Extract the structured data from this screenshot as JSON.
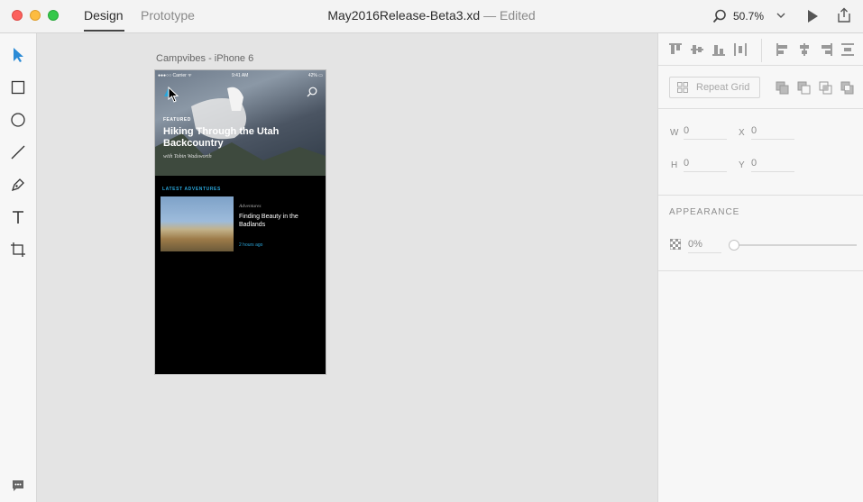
{
  "window": {
    "tabs": [
      {
        "label": "Design"
      },
      {
        "label": "Prototype"
      }
    ],
    "document_name": "May2016Release-Beta3.xd",
    "document_state": "— Edited",
    "zoom": "50.7%"
  },
  "toolbar": {
    "tools": [
      "select-tool",
      "rectangle-tool",
      "ellipse-tool",
      "line-tool",
      "pen-tool",
      "text-tool",
      "artboard-tool",
      "comment-tool"
    ]
  },
  "canvas": {
    "artboard_label": "Campvibes - iPhone 6",
    "artboard": {
      "status": {
        "carrier": "●●●○○ Carrier ᯤ",
        "time": "9:41 AM",
        "battery": "42% ▭"
      },
      "hero": {
        "kicker": "FEATURED",
        "title": "Hiking Through the Utah Backcountry",
        "byline": "with Tobin Wadsworth"
      },
      "section_label": "LATEST ADVENTURES",
      "card": {
        "category": "Adventures",
        "title": "Finding Beauty in the Badlands",
        "time": "2 hours ago"
      }
    }
  },
  "panel": {
    "repeat_grid": "Repeat Grid",
    "dimensions": {
      "w_label": "W",
      "w_value": "0",
      "x_label": "X",
      "x_value": "0",
      "h_label": "H",
      "h_value": "0",
      "y_label": "Y",
      "y_value": "0"
    },
    "appearance": {
      "title": "APPEARANCE",
      "opacity": "0%"
    }
  },
  "colors": {
    "accent": "#2aa5d9",
    "select_tool": "#2c8bd6"
  }
}
